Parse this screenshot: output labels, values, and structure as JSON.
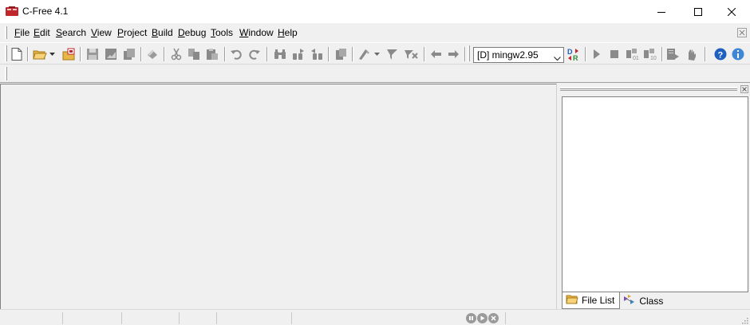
{
  "window": {
    "title": "C-Free 4.1",
    "controls": [
      "minimize-icon",
      "maximize-icon",
      "close-icon"
    ]
  },
  "menubar": {
    "items": [
      {
        "label": "File",
        "accel": "F"
      },
      {
        "label": "Edit",
        "accel": "E"
      },
      {
        "label": "Search",
        "accel": "S"
      },
      {
        "label": "View",
        "accel": "V"
      },
      {
        "label": "Project",
        "accel": "P"
      },
      {
        "label": "Build",
        "accel": "B"
      },
      {
        "label": "Debug",
        "accel": "D"
      },
      {
        "label": "Tools",
        "accel": "T"
      },
      {
        "label": "Window",
        "accel": "W"
      },
      {
        "label": "Help",
        "accel": "H"
      }
    ]
  },
  "toolbar": {
    "compiler": {
      "selected": "[D] mingw2.95"
    },
    "buttons": [
      "new-file-icon",
      "open-folder-icon",
      "open-dropdown-icon",
      "open-project-icon",
      "save-icon",
      "save-all-icon",
      "close-file-icon",
      "print-icon",
      "cut-icon",
      "copy-icon",
      "paste-icon",
      "undo-icon",
      "redo-icon",
      "find-icon",
      "find-next-icon",
      "find-previous-icon",
      "replace-icon",
      "build-icon",
      "run-dropdown-icon",
      "bookmark-icon",
      "clear-bookmarks-icon",
      "back-icon",
      "forward-icon",
      "debug-release-icon",
      "run-icon",
      "stop-icon",
      "step-icon",
      "step-over-icon",
      "watch-icon",
      "breakpoint-icon",
      "help-icon",
      "info-icon"
    ]
  },
  "dock": {
    "tabs": [
      {
        "label": "File List",
        "icon": "folder-icon",
        "active": true
      },
      {
        "label": "Class",
        "icon": "class-icon",
        "active": false
      }
    ]
  },
  "colors": {
    "chrome": "#f0f0f0",
    "pane": "#ffffff",
    "icon_gray": "#8a8a8a",
    "icon_blue": "#1f5fbf",
    "icon_red": "#c0272d"
  }
}
